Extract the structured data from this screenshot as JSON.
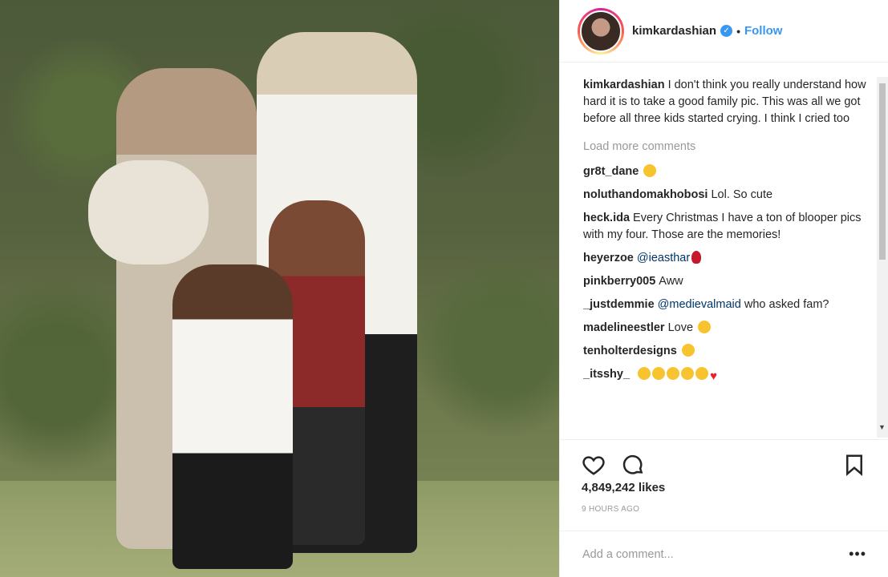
{
  "post": {
    "username": "kimkardashian",
    "verified_icon": "verified-badge-icon",
    "follow_separator": "•",
    "follow_label": "Follow",
    "caption_user": "kimkardashian",
    "caption_text": "I don't think you really understand how hard it is to take a good family pic. This was all we got before all three kids started crying. I think I cried too",
    "load_more_label": "Load more comments",
    "likes": "4,849,242 likes",
    "timestamp": "9 HOURS AGO",
    "add_comment_placeholder": "Add a comment...",
    "more_label": "•••"
  },
  "comments": [
    {
      "user": "gr8t_dane",
      "text": ""
    },
    {
      "user": "noluthandomakhobosi",
      "text": "Lol. So cute"
    },
    {
      "user": "heck.ida",
      "text": "Every Christmas I have a ton of blooper pics with my four. Those are the memories!"
    },
    {
      "user": "heyerzoe",
      "mention": "@ieasthar",
      "text": ""
    },
    {
      "user": "pinkberry005",
      "text": "Aww"
    },
    {
      "user": "_justdemmie",
      "mention": "@medievalmaid",
      "text": "who asked fam?"
    },
    {
      "user": "madelineestler",
      "text": "Love"
    },
    {
      "user": "tenholterdesigns",
      "text": ""
    },
    {
      "user": "_itsshy_",
      "text": ""
    }
  ],
  "colors": {
    "link_blue": "#3897f0",
    "text": "#262626",
    "muted": "#999999",
    "mention": "#003569"
  }
}
